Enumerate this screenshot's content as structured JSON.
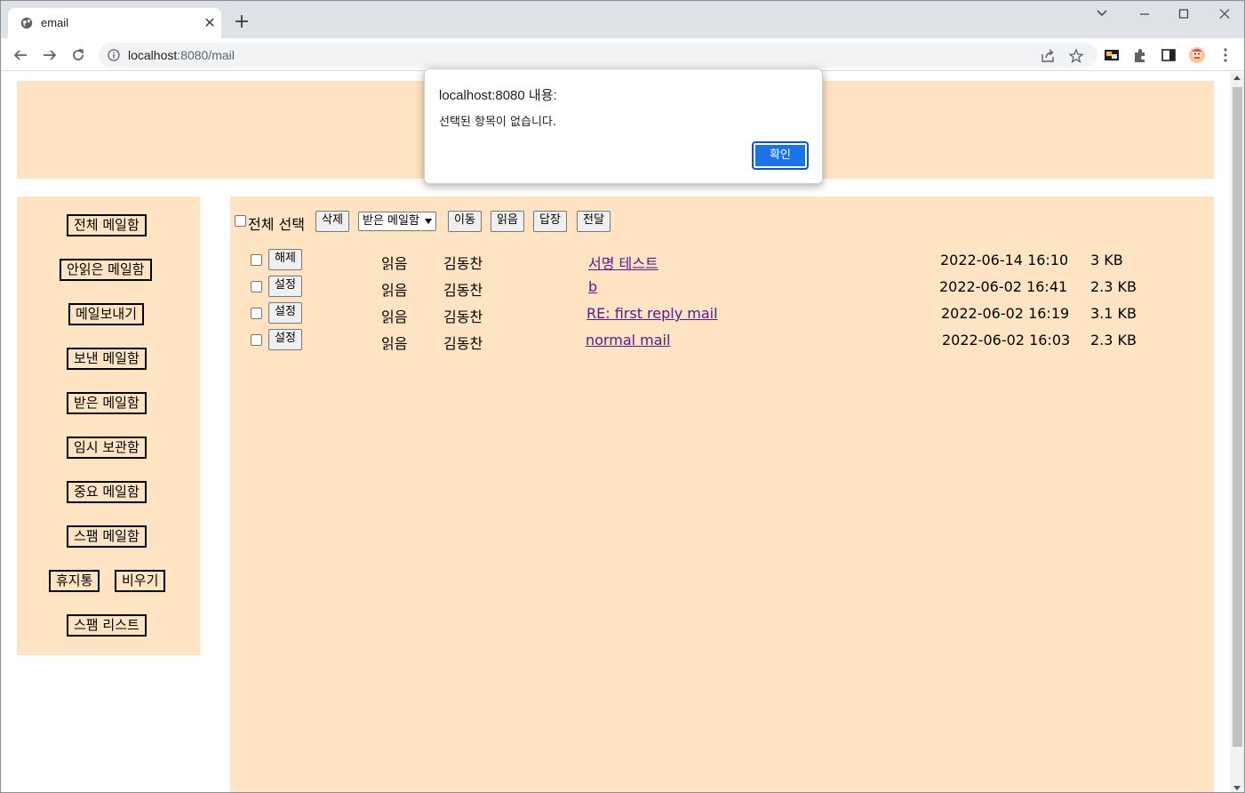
{
  "browser": {
    "tab_title": "email",
    "tab_close": "✕",
    "new_tab": "+",
    "url_host": "localhost",
    "url_rest": ":8080/mail"
  },
  "sidebar": {
    "all_mail": "전체 메일함",
    "unread_mail": "안읽은 메일함",
    "compose": "메일보내기",
    "sent_mail": "보낸 메일함",
    "inbox": "받은 메일함",
    "drafts": "임시 보관함",
    "important": "중요 메일함",
    "spam": "스팸 메일함",
    "trash": "휴지통",
    "empty": "비우기",
    "spam_list": "스팸 리스트"
  },
  "toolbar": {
    "select_all": "전체 선택",
    "delete": "삭제",
    "folder_select": "받은 메일함",
    "move": "이동",
    "read": "읽음",
    "reply": "답장",
    "forward": "전달"
  },
  "mails": [
    {
      "flag_button": "해제",
      "status": "읽음",
      "sender": "김동찬",
      "subject": "서명 테스트",
      "date": "2022-06-14 16:10",
      "size": "3 KB"
    },
    {
      "flag_button": "설정",
      "status": "읽음",
      "sender": "김동찬",
      "subject": "b",
      "date": "2022-06-02 16:41",
      "size": "2.3 KB"
    },
    {
      "flag_button": "설정",
      "status": "읽음",
      "sender": "김동찬",
      "subject": "RE: first reply mail",
      "date": "2022-06-02 16:19",
      "size": "3.1 KB"
    },
    {
      "flag_button": "설정",
      "status": "읽음",
      "sender": "김동찬",
      "subject": "normal mail",
      "date": "2022-06-02 16:03",
      "size": "2.3 KB"
    }
  ],
  "dialog": {
    "title": "localhost:8080 내용:",
    "message": "선택된 항목이 없습니다.",
    "ok": "확인"
  },
  "colors": {
    "panel_bg": "#ffe4c4",
    "link": "#551a8b",
    "dialog_button": "#1a73e8"
  }
}
